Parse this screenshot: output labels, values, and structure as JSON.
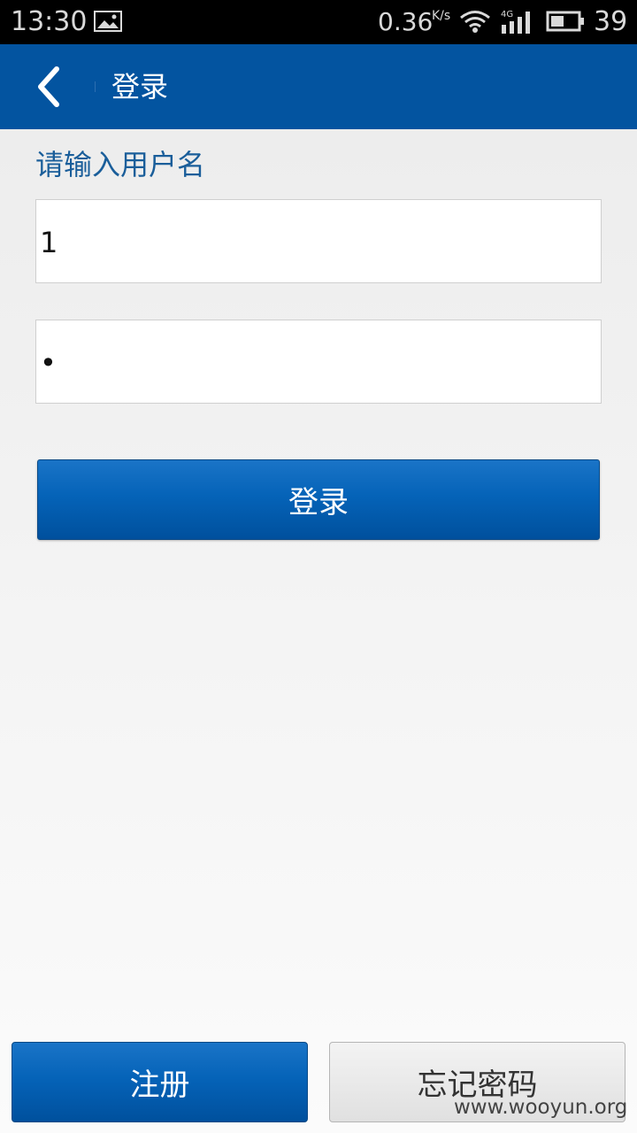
{
  "status_bar": {
    "time": "13:30",
    "speed": "0.36",
    "speed_unit": "K/s",
    "network": "4G",
    "battery": "39",
    "icons": [
      "image-icon",
      "wifi-icon",
      "signal-icon",
      "battery-icon"
    ]
  },
  "header": {
    "title": "登录",
    "back_icon": "chevron-left-icon"
  },
  "form": {
    "label": "请输入用户名",
    "username_value": "1",
    "password_value": "•",
    "login_label": "登录"
  },
  "bottom": {
    "register_label": "注册",
    "forgot_label": "忘记密码"
  },
  "watermark": "www.wooyun.org",
  "colors": {
    "header": "#0354a0",
    "accent": "#0563b8",
    "label": "#1a5e9a"
  }
}
